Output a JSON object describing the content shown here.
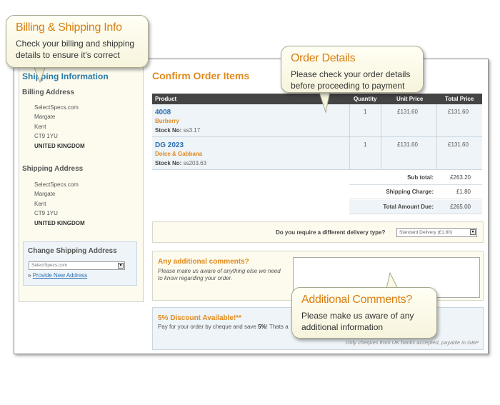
{
  "sidebar": {
    "title": "Shipping Information",
    "billing_heading": "Billing Address",
    "billing_lines": [
      "SelectSpecs.com",
      "Margate",
      "Kent",
      "CT9 1YU",
      "UNITED KINGDOM"
    ],
    "shipping_heading": "Shipping Address",
    "shipping_lines": [
      "SelectSpecs.com",
      "Margate",
      "Kent",
      "CT9 1YU",
      "UNITED KINGDOM"
    ],
    "change_title": "Change Shipping Address",
    "address_select_value": "SelectSpecs.com",
    "provide_prefix": "»",
    "provide_link": "Provide New Address"
  },
  "main": {
    "title": "Confirm Order Items",
    "columns": {
      "product": "Product",
      "quantity": "Quantity",
      "unit_price": "Unit Price",
      "total_price": "Total Price"
    },
    "stock_label": "Stock No:",
    "items": [
      {
        "code": "4008",
        "brand": "Burberry",
        "stock": "ss3.17",
        "quantity": "1",
        "unit_price": "£131.60",
        "total_price": "£131.60"
      },
      {
        "code": "DG 2023",
        "brand": "Dolce & Gabbana",
        "stock": "ss203.63",
        "quantity": "1",
        "unit_price": "£131.60",
        "total_price": "£131.60"
      }
    ],
    "subtotal_label": "Sub total:",
    "subtotal": "£263.20",
    "shipping_label": "Shipping Charge:",
    "shipping": "£1.80",
    "total_label": "Total Amount Due:",
    "total": "£265.00",
    "delivery_question": "Do you require a different delivery type?",
    "delivery_value": "Standard Delivery (£1.80)",
    "comments_title": "Any additional comments?",
    "comments_desc": "Please make us aware of anything else we need to know regarding your order.",
    "discount_title": "5% Discount Available!**",
    "discount_desc_pre": "Pay for your order by cheque and save",
    "discount_pct": "5%",
    "discount_desc_post": "! Thats a",
    "discount_note": "Only cheques from UK banks accepted, payable in GBP"
  },
  "callouts": {
    "billing": {
      "title": "Billing & Shipping Info",
      "line1": "Check your billing and shipping",
      "line2": "details to ensure it's correct"
    },
    "order": {
      "title": "Order Details",
      "line1": "Please check your order details",
      "line2": "before proceeding to payment"
    },
    "comments": {
      "title": "Additional Comments?",
      "line1": "Please make us aware of any",
      "line2": "additional information"
    }
  }
}
